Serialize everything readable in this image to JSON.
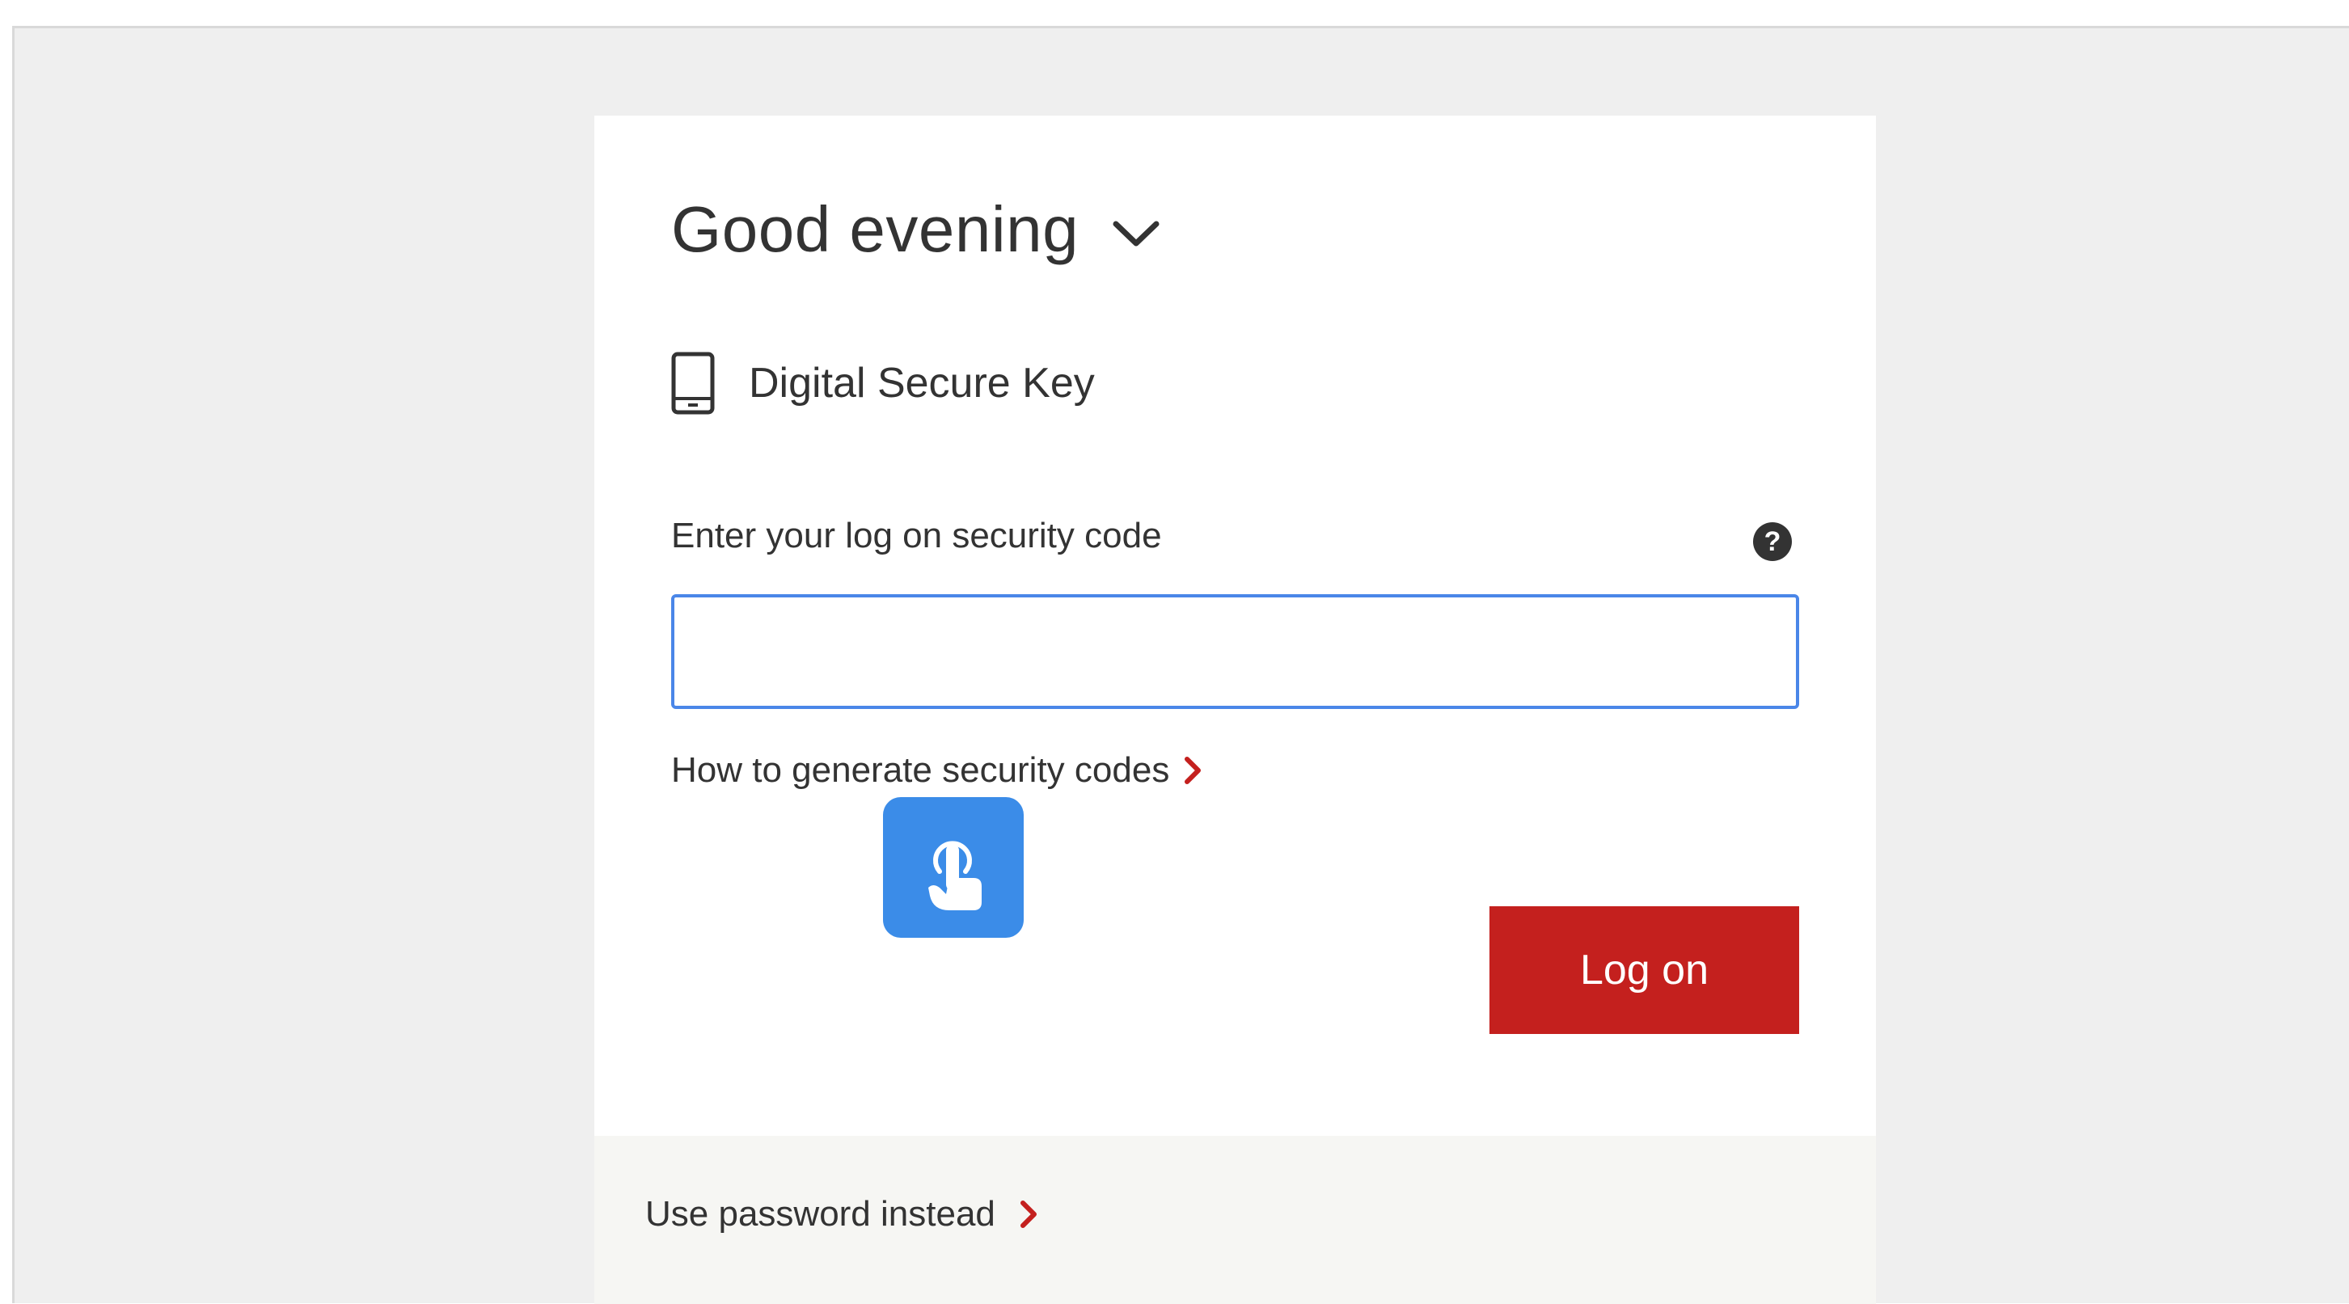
{
  "greeting": {
    "text": "Good evening",
    "toggle_icon": "chevron-down-icon"
  },
  "method": {
    "icon": "mobile-phone-icon",
    "label": "Digital Secure Key"
  },
  "security_code": {
    "label": "Enter your log on security code",
    "help_icon": "question-mark-icon",
    "help_glyph": "?",
    "value": "",
    "placeholder": ""
  },
  "generate_link": {
    "text": "How to generate security codes",
    "icon": "chevron-right-icon"
  },
  "touch_badge": {
    "icon": "tap-finger-icon"
  },
  "logon_button": {
    "label": "Log on"
  },
  "footer": {
    "password_link": "Use password instead",
    "icon": "chevron-right-icon"
  },
  "colors": {
    "page_background": "#efefef",
    "card_background": "#ffffff",
    "footer_background": "#f6f6f3",
    "text": "#333333",
    "accent_red": "#c4201e",
    "input_focus_blue": "#4a86e8",
    "touch_badge_blue": "#3b8ce8"
  }
}
